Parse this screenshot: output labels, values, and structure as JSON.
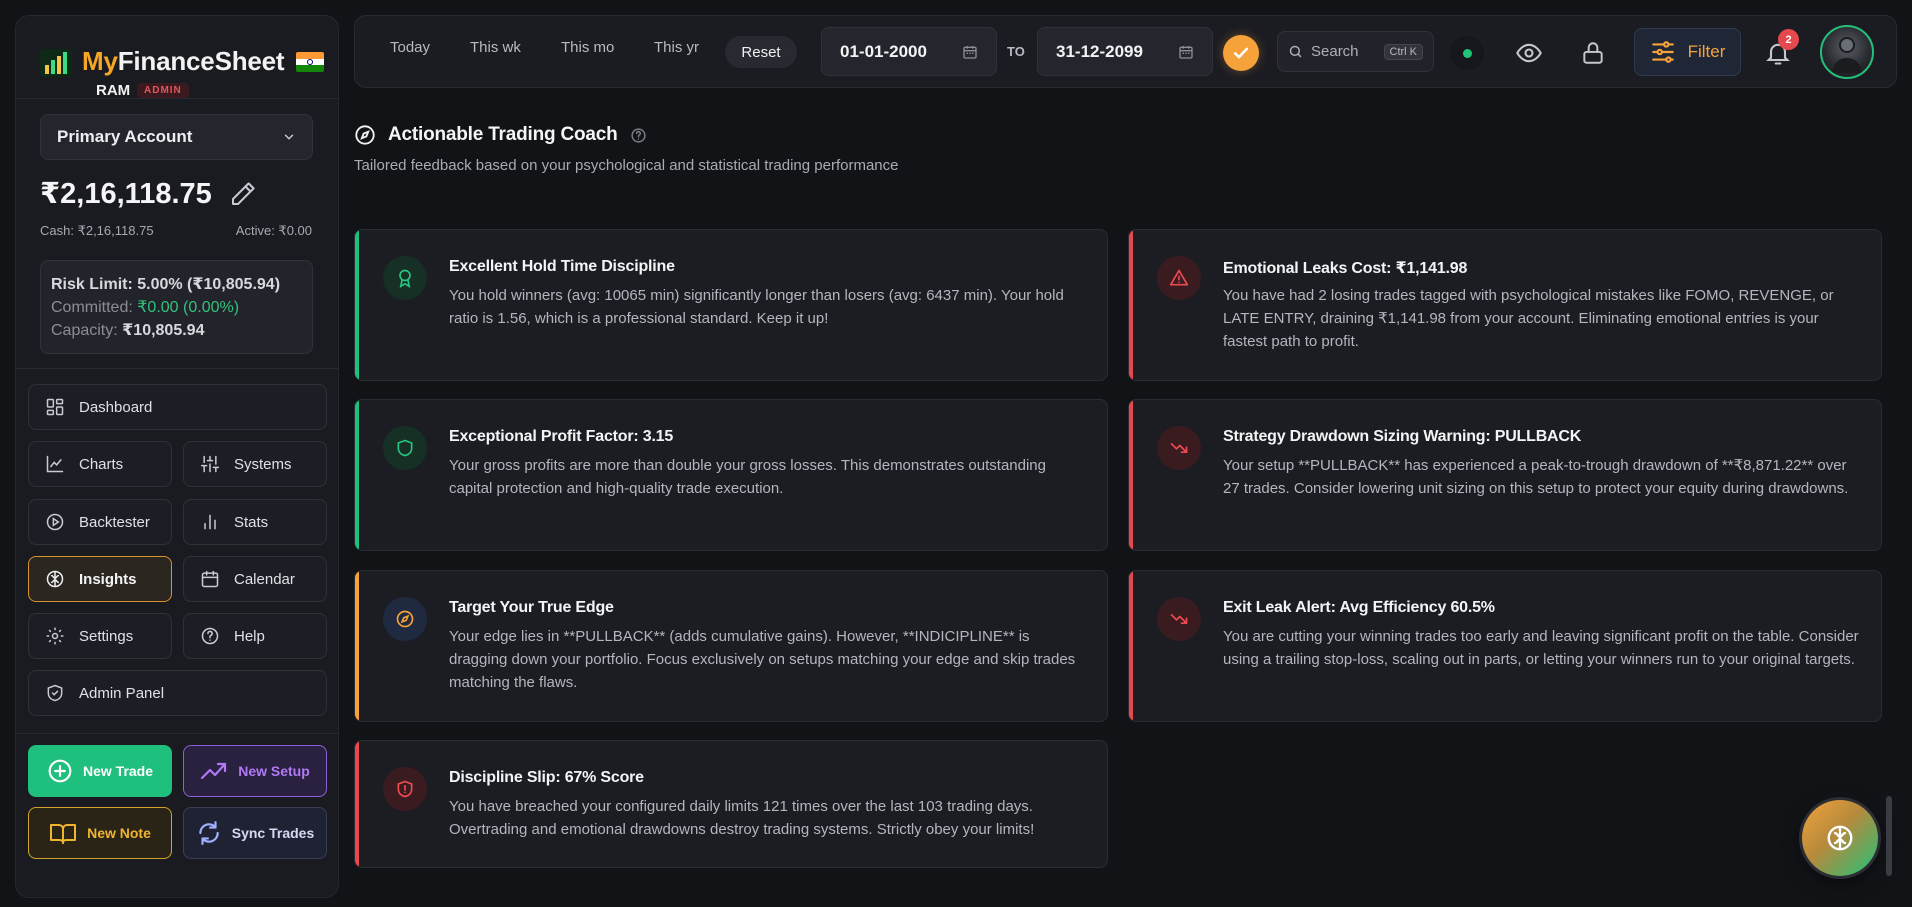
{
  "brand": {
    "name_part1": "My",
    "name_part2": "FinanceSheet",
    "user": "RAM",
    "role_badge": "ADMIN"
  },
  "account": {
    "selected": "Primary Account",
    "balance": "₹2,16,118.75",
    "cash": "Cash: ₹2,16,118.75",
    "active": "Active: ₹0.00",
    "risk_limit": "Risk Limit: 5.00% (₹10,805.94)",
    "committed_label": "Committed:",
    "committed_value": "₹0.00 (0.00%)",
    "capacity_label": "Capacity:",
    "capacity_value": "₹10,805.94"
  },
  "nav": {
    "dashboard": "Dashboard",
    "charts": "Charts",
    "systems": "Systems",
    "backtester": "Backtester",
    "stats": "Stats",
    "insights": "Insights",
    "calendar": "Calendar",
    "settings": "Settings",
    "help": "Help",
    "admin": "Admin Panel"
  },
  "actions": {
    "new_trade": "New Trade",
    "new_setup": "New Setup",
    "new_note": "New Note",
    "sync_trades": "Sync Trades"
  },
  "topbar": {
    "ranges": [
      "Today",
      "This wk",
      "This mo",
      "This yr"
    ],
    "reset": "Reset",
    "date_from": "01-01-2000",
    "to_label": "TO",
    "date_to": "31-12-2099",
    "search_placeholder": "Search",
    "search_shortcut": "Ctrl K",
    "filter": "Filter",
    "notifications": "2"
  },
  "section": {
    "title": "Actionable Trading Coach",
    "subtitle": "Tailored feedback based on your psychological and statistical trading performance"
  },
  "cards": [
    {
      "title": "Excellent Hold Time Discipline",
      "body": "You hold winners (avg: 10065 min) significantly longer than losers (avg: 6437 min). Your hold ratio is 1.56, which is a professional standard. Keep it up!",
      "icon": "award-icon",
      "tone": "green"
    },
    {
      "title": "Emotional Leaks Cost: ₹1,141.98",
      "body": "You have had 2 losing trades tagged with psychological mistakes like FOMO, REVENGE, or LATE ENTRY, draining ₹1,141.98 from your account. Eliminating emotional entries is your fastest path to profit.",
      "icon": "warning-triangle-icon",
      "tone": "red"
    },
    {
      "title": "Exceptional Profit Factor: 3.15",
      "body": "Your gross profits are more than double your gross losses. This demonstrates outstanding capital protection and high-quality trade execution.",
      "icon": "shield-icon",
      "tone": "green"
    },
    {
      "title": "Strategy Drawdown Sizing Warning: PULLBACK",
      "body": "Your setup **PULLBACK** has experienced a peak-to-trough drawdown of **₹8,871.22** over 27 trades. Consider lowering unit sizing on this setup to protect your equity during drawdowns.",
      "icon": "trending-down-icon",
      "tone": "red"
    },
    {
      "title": "Target Your True Edge",
      "body": "Your edge lies in **PULLBACK** (adds cumulative gains). However, **INDICIPLINE** is dragging down your portfolio. Focus exclusively on setups matching your edge and skip trades matching the flaws.",
      "icon": "compass-icon",
      "tone": "orange"
    },
    {
      "title": "Exit Leak Alert: Avg Efficiency 60.5%",
      "body": "You are cutting your winning trades too early and leaving significant profit on the table. Consider using a trailing stop-loss, scaling out in parts, or letting your winners run to your original targets.",
      "icon": "trending-down-icon",
      "tone": "red"
    },
    {
      "title": "Discipline Slip: 67% Score",
      "body": "You have breached your configured daily limits 121 times over the last 103 trading days. Overtrading and emotional drawdowns destroy trading systems. Strictly obey your limits!",
      "icon": "shield-alert-icon",
      "tone": "red"
    }
  ],
  "colors": {
    "accent_orange": "#f5a23a",
    "green": "#22c47a",
    "red": "#e5484d",
    "purple": "#a66bf0"
  }
}
